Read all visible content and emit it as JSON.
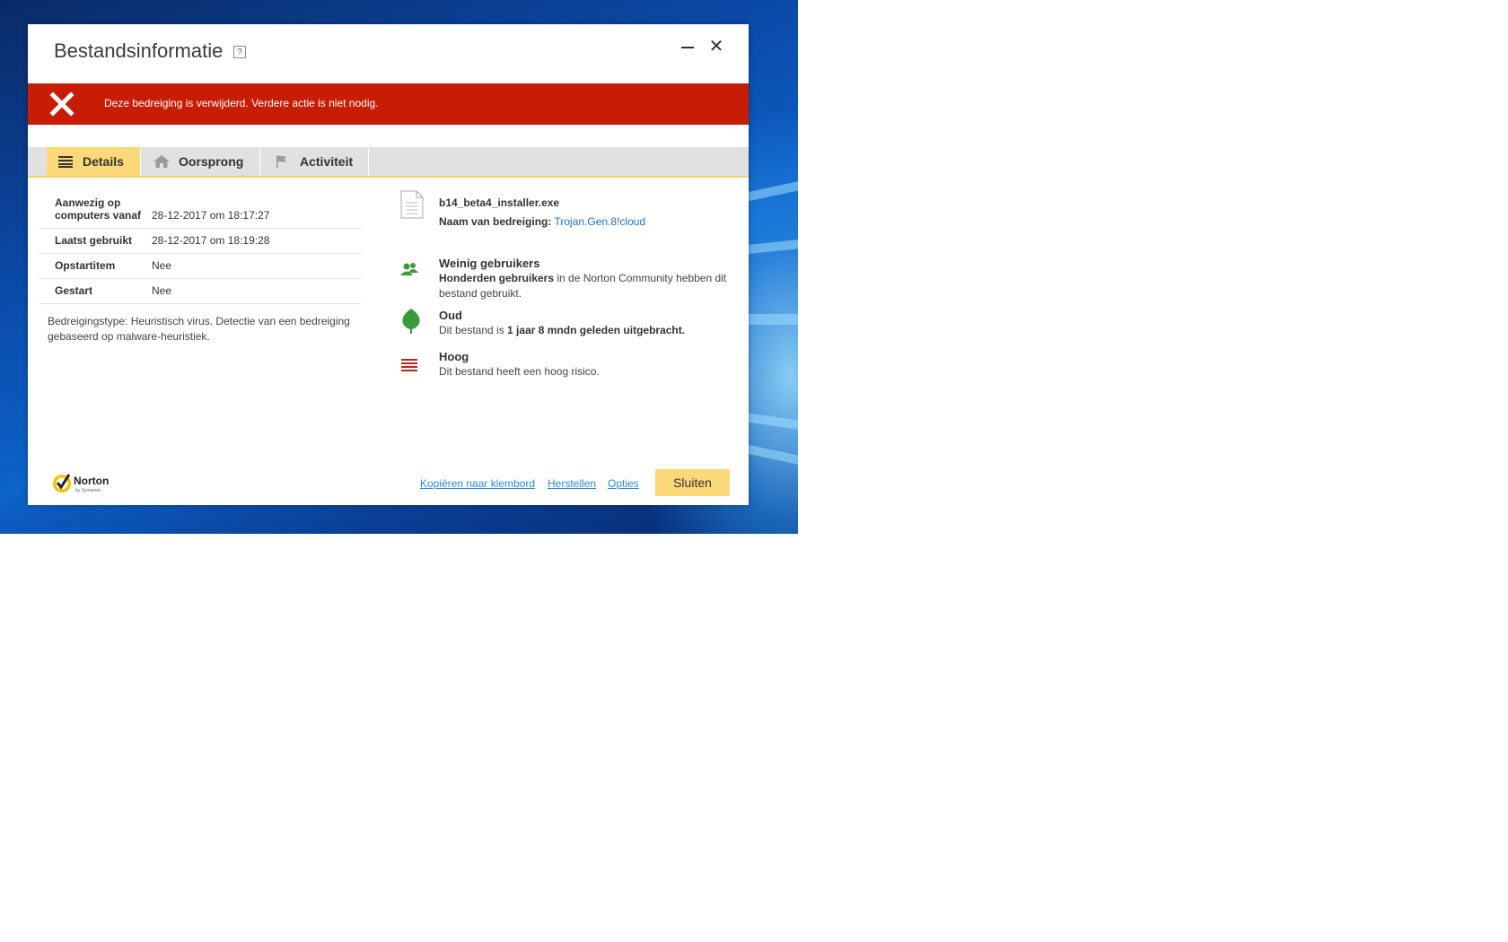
{
  "dialog": {
    "title": "Bestandsinformatie",
    "help_label": "?",
    "close_symbol": "✕"
  },
  "alert": {
    "message": "Deze bedreiging is verwijderd. Verdere actie is niet nodig.",
    "color": "#c81d05"
  },
  "tabs": [
    {
      "label": "Details",
      "icon": "list-icon",
      "active": true
    },
    {
      "label": "Oorsprong",
      "icon": "home-icon",
      "active": false
    },
    {
      "label": "Activiteit",
      "icon": "flag-icon",
      "active": false
    }
  ],
  "details": [
    {
      "label": "Aanwezig op computers vanaf",
      "value": "28-12-2017 om 18:17:27"
    },
    {
      "label": "Laatst gebruikt",
      "value": "28-12-2017 om 18:19:28"
    },
    {
      "label": "Opstartitem",
      "value": "Nee"
    },
    {
      "label": "Gestart",
      "value": "Nee"
    }
  ],
  "threat_note": "Bedreigingstype: Heuristisch virus. Detectie van een bedreiging gebaseerd op malware-heuristiek.",
  "file": {
    "name": "b14_beta4_installer.exe",
    "threat_label": "Naam van bedreiging:",
    "threat_name": "Trojan.Gen.8!cloud"
  },
  "users": {
    "title": "Weinig gebruikers",
    "bold": "Honderden gebruikers",
    "rest": " in de Norton Community hebben dit bestand gebruikt."
  },
  "age": {
    "title": "Oud",
    "prefix": "Dit bestand is ",
    "bold": "1 jaar 8 mndn geleden uitgebracht."
  },
  "risk": {
    "title": "Hoog",
    "text": "Dit bestand heeft een hoog risico."
  },
  "footer": {
    "copy_link": "Kopiëren naar klembord",
    "restore_link": "Herstellen",
    "options_link": "Opties",
    "close_button": "Sluiten",
    "logo_text": "Norton",
    "logo_sub": "by Symantec"
  },
  "colors": {
    "accent": "#fbd878",
    "link": "#2a8ad4",
    "green": "#3b9a3b",
    "risk_red": "#c0261b"
  }
}
